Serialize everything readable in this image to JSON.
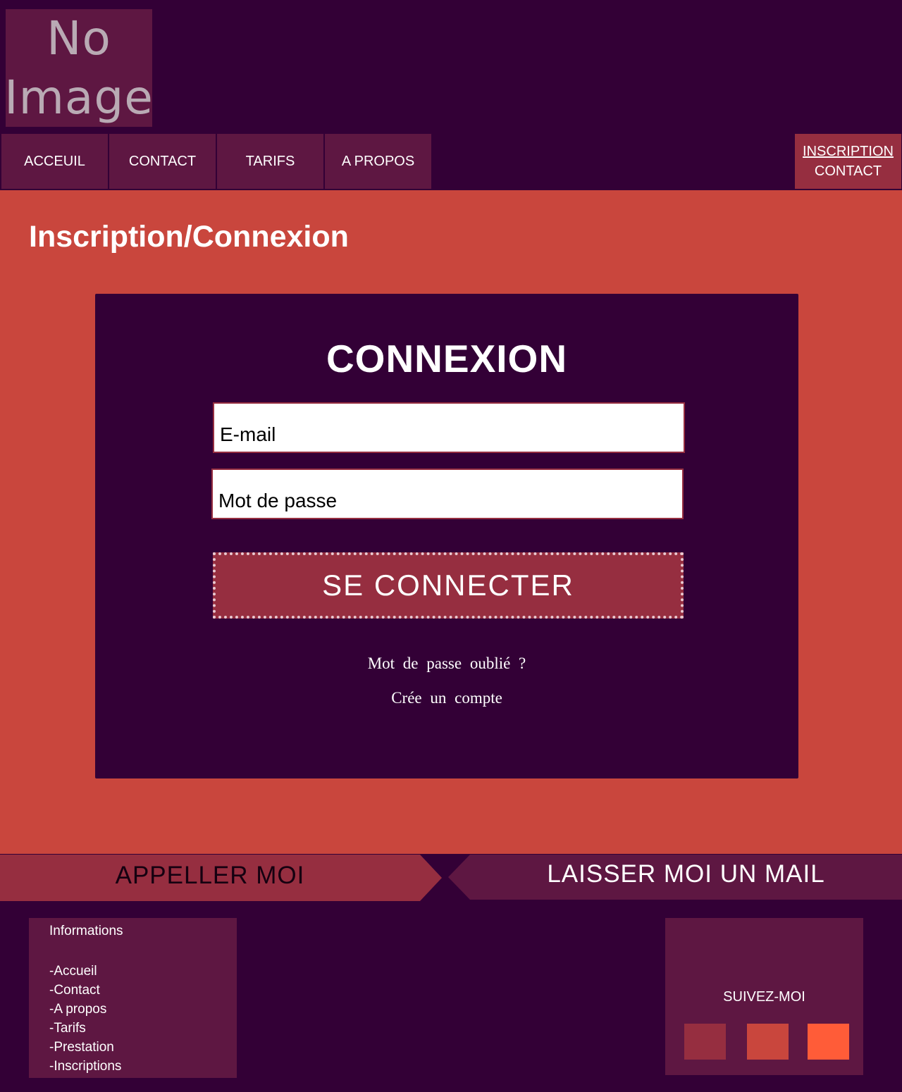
{
  "header": {
    "logo_line1": "No",
    "logo_line2": "Image"
  },
  "nav": {
    "items": [
      {
        "label": "ACCEUIL"
      },
      {
        "label": "CONTACT"
      },
      {
        "label": "TARIFS"
      },
      {
        "label": "A PROPOS"
      }
    ]
  },
  "auth": {
    "inscription_label": "INSCRIPTION",
    "contact_label": "CONTACT"
  },
  "main": {
    "page_title": "Inscription/Connexion",
    "card": {
      "title": "CONNEXION",
      "email_placeholder": "E-mail",
      "password_placeholder": "Mot de passe",
      "submit_label": "SE CONNECTER",
      "forgot_label": "Mot de passe oublié ?",
      "create_label": "Crée un compte"
    }
  },
  "band": {
    "call_label": "APPELLER MOI",
    "mail_label": "LAISSER MOI UN MAIL"
  },
  "footer": {
    "info_title": "Informations",
    "info_links": [
      "-Accueil",
      "-Contact",
      "-A propos",
      "-Tarifs",
      "-Prestation",
      "-Inscriptions"
    ],
    "follow_title": "SUIVEZ-MOI",
    "social_colors": [
      "#962e40",
      "#c9463d",
      "#ff5c38"
    ]
  },
  "colors": {
    "background": "#330036",
    "panel": "#5e1742",
    "accent": "#962e40",
    "main_bg": "#c9463d"
  }
}
